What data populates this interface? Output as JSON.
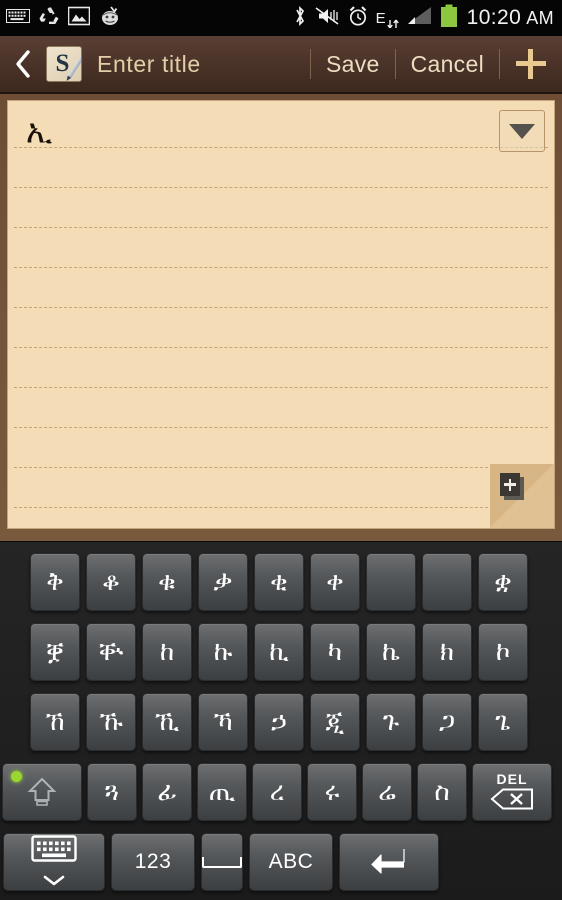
{
  "statusbar": {
    "left_icons": [
      "keyboard-icon",
      "sync-icon",
      "screenshot-image-icon",
      "yahoo-mail-icon"
    ],
    "right_icons": [
      "bluetooth-icon",
      "vibrate-mute-icon",
      "alarm-clock-icon",
      "edge-data-icon",
      "signal-bars-icon",
      "battery-icon"
    ],
    "network_type": "E",
    "time": "10:20",
    "ampm": "AM",
    "battery_color": "#8dc63f"
  },
  "titlebar": {
    "back_icon": "chevron-left-icon",
    "app_icon": "smemo-icon",
    "app_icon_letter": "S",
    "title_placeholder": "Enter  title",
    "save_label": "Save",
    "cancel_label": "Cancel",
    "add_icon": "plus-icon",
    "bg_color": "#4b3329",
    "text_color": "#e2cfa8"
  },
  "note": {
    "content": "ኢ",
    "paper_color": "#f4dcb7",
    "frame_color": "#6d4d36",
    "dropdown_icon": "chevron-down-icon",
    "add_page_icon": "add-page-icon",
    "rule_count": 11
  },
  "keyboard": {
    "rows": [
      {
        "name": "row-1",
        "keys": [
          {
            "glyph": "ቅ",
            "name": "key-eth-qe"
          },
          {
            "glyph": "ቆ",
            "name": "key-eth-qo"
          },
          {
            "glyph": "ቁ",
            "name": "key-eth-qu"
          },
          {
            "glyph": "ቃ",
            "name": "key-eth-qwa"
          },
          {
            "glyph": "ቂ",
            "name": "key-eth-qi"
          },
          {
            "glyph": "ቀ",
            "name": "key-eth-qa"
          },
          {
            "glyph": "቎",
            "name": "key-eth-qho"
          },
          {
            "glyph": "቉",
            "name": "key-eth-qhu"
          },
          {
            "glyph": "ቋ",
            "name": "key-eth-qhwa"
          }
        ]
      },
      {
        "name": "row-2",
        "keys": [
          {
            "glyph": "ቛ",
            "name": "key-eth-qwaa"
          },
          {
            "glyph": "ቝ",
            "name": "key-eth-qwee"
          },
          {
            "glyph": "ከ",
            "name": "key-eth-ka"
          },
          {
            "glyph": "ኩ",
            "name": "key-eth-ku"
          },
          {
            "glyph": "ኪ",
            "name": "key-eth-ki"
          },
          {
            "glyph": "ካ",
            "name": "key-eth-kaa"
          },
          {
            "glyph": "ኬ",
            "name": "key-eth-kee"
          },
          {
            "glyph": "ክ",
            "name": "key-eth-ke"
          },
          {
            "glyph": "ኮ",
            "name": "key-eth-ko"
          }
        ]
      },
      {
        "name": "row-3",
        "keys": [
          {
            "glyph": "ኸ",
            "name": "key-eth-kxa"
          },
          {
            "glyph": "ኹ",
            "name": "key-eth-kxu"
          },
          {
            "glyph": "ኺ",
            "name": "key-eth-kxi"
          },
          {
            "glyph": "ኻ",
            "name": "key-eth-kxaa"
          },
          {
            "glyph": "ኃ",
            "name": "key-eth-hwa"
          },
          {
            "glyph": "ጂ",
            "name": "key-eth-go"
          },
          {
            "glyph": "ጉ",
            "name": "key-eth-gu"
          },
          {
            "glyph": "ጋ",
            "name": "key-eth-gwa"
          },
          {
            "glyph": "ጌ",
            "name": "key-eth-gee"
          }
        ]
      },
      {
        "name": "row-4",
        "keys": [
          {
            "glyph": "ጓ",
            "name": "key-eth-gwu"
          },
          {
            "glyph": "ፊ",
            "name": "key-eth-fwa"
          },
          {
            "glyph": "ጢ",
            "name": "key-eth-tswa"
          },
          {
            "glyph": "ረ",
            "name": "key-eth-ra"
          },
          {
            "glyph": "ሩ",
            "name": "key-eth-ru"
          },
          {
            "glyph": "ሬ",
            "name": "key-eth-ree"
          },
          {
            "glyph": "ስ",
            "name": "key-eth-se"
          }
        ],
        "shift": {
          "name": "shift-key",
          "icon": "shift-arrow-icon",
          "led_color": "#9ad62e"
        },
        "delete": {
          "name": "delete-key",
          "label": "DEL",
          "icon": "backspace-icon"
        }
      },
      {
        "name": "row-5",
        "hide_keyboard": {
          "name": "hide-keyboard-key",
          "icon": "keyboard-down-icon"
        },
        "numbers": {
          "name": "numeric-mode-key",
          "label": "123"
        },
        "space": {
          "name": "space-key",
          "icon": "space-bar-icon"
        },
        "alpha": {
          "name": "alpha-mode-key",
          "label": "ABC"
        },
        "enter": {
          "name": "enter-key",
          "icon": "return-arrow-icon"
        }
      }
    ]
  }
}
